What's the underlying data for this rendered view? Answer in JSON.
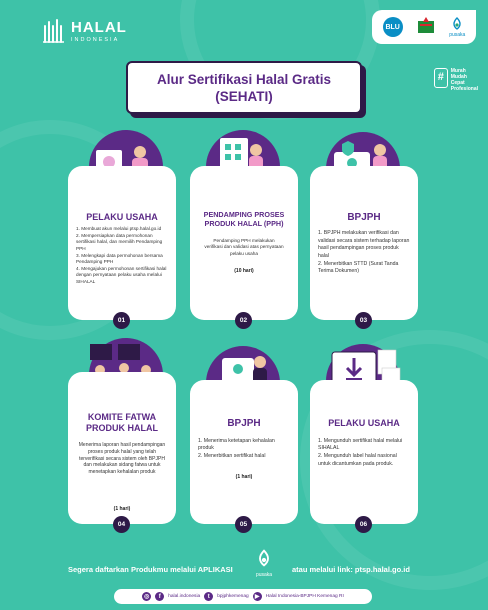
{
  "header": {
    "logo_word": "HALAL",
    "logo_sub": "INDONESIA",
    "partners": [
      "BLU",
      "Kementerian Agama",
      "pusaka"
    ],
    "title_line1": "Alur Sertifikasi Halal Gratis",
    "title_line2": "(SEHATI)",
    "tagline": [
      "Murah",
      "Mudah",
      "Cepat",
      "Profesional"
    ]
  },
  "cards": [
    {
      "title": "PELAKU USAHA",
      "steps": [
        "1. Membuat akun melalui ptsp.halal.go.id",
        "2. Mempersiapkan data permohonan sertifikasi halal, dan memilih Pendamping PPH",
        "3. Melengkapi data permohonan bersama Pendamping PPH",
        "4. Mengajukan permohonan sertifikasi halal dengan pernyataan pelaku usaha melalui SIHALAL"
      ],
      "duration": "",
      "number": "01"
    },
    {
      "title": "PENDAMPING PROSES PRODUK HALAL (PPH)",
      "steps": [
        "Pendamping PPH melakukan verifikasi dan validasi atas pernyataan pelaku usaha"
      ],
      "duration": "(10 hari)",
      "number": "02"
    },
    {
      "title": "BPJPH",
      "steps": [
        "1. BPJPH melakukan verifikasi dan validasi secara sistem terhadap laporan hasil pendampingan proses produk halal",
        "2. Menerbitkan STTD (Surat Tanda Terima Dokumen)"
      ],
      "duration": "",
      "number": "03"
    },
    {
      "title": "KOMITE FATWA PRODUK HALAL",
      "steps": [
        "Menerima laporan hasil pendampingan proses produk halal yang telah terverifikasi secara sistem oleh BPJPH dan melakukan sidang fatwa untuk menetapkan kehalalan produk"
      ],
      "duration": "(1 hari)",
      "number": "04"
    },
    {
      "title": "BPJPH",
      "steps": [
        "1. Menerima ketetapan kehalalan produk",
        "2. Menerbitkan sertifikat halal"
      ],
      "duration": "(1 hari)",
      "number": "05"
    },
    {
      "title": "PELAKU USAHA",
      "steps": [
        "1. Mengunduh sertifikat halal melalui SIHALAL",
        "2. Mengunduh label halal nasional untuk dicantumkan pada produk."
      ],
      "duration": "",
      "number": "06"
    }
  ],
  "footer": {
    "cta_left": "Segera daftarkan Produkmu melalui APLIKASI",
    "app_name": "pusaka",
    "cta_right": "atau melalui link: ptsp.halal.go.id",
    "social": [
      "halal.indonesia",
      "bpjphkemenag",
      "Halal Indonesia-BPJPH Kemenag RI"
    ]
  },
  "colors": {
    "background": "#3ec2a8",
    "primary": "#5b2a86",
    "dark": "#2e1a47",
    "card": "#ffffff"
  }
}
